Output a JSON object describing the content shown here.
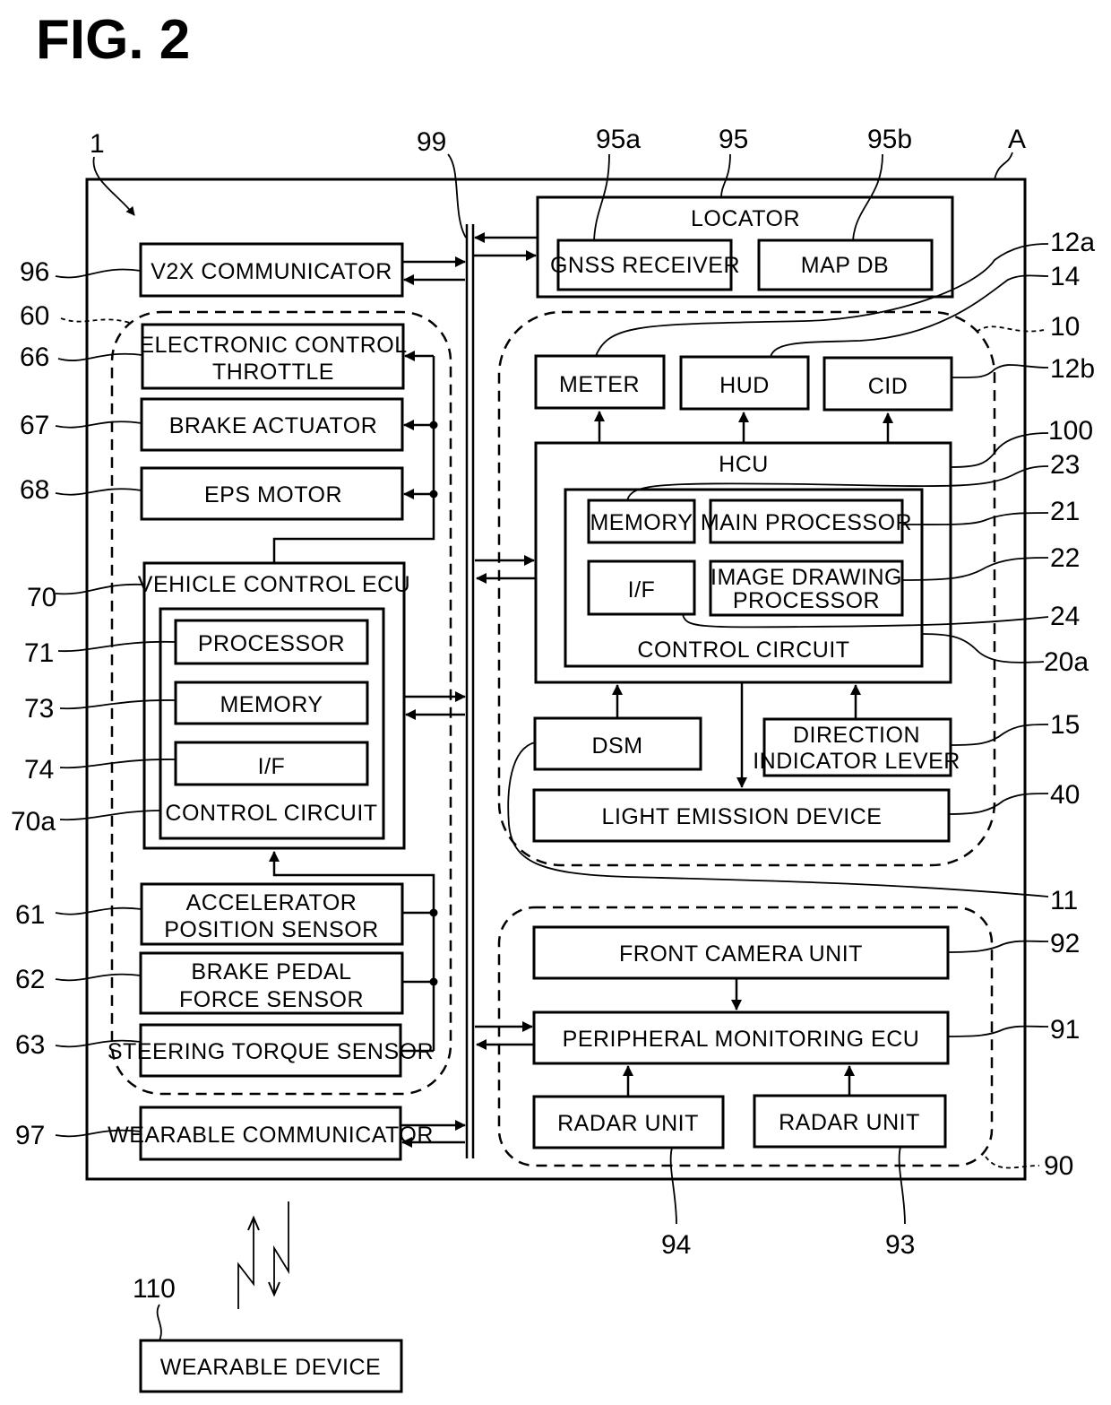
{
  "figure": {
    "title": "FIG. 2"
  },
  "refs": {
    "system": "1",
    "bus": "99",
    "locator": "95",
    "gnss": "95a",
    "mapdb": "95b",
    "vehicle": "A",
    "v2x": "96",
    "group60": "60",
    "throttle": "66",
    "brake_act": "67",
    "eps": "68",
    "vecu": "70",
    "processor": "71",
    "vmemory": "73",
    "vif": "74",
    "vcc": "70a",
    "accel": "61",
    "brake_ped": "62",
    "steer": "63",
    "wear_comm": "97",
    "meter": "12a",
    "hud": "14",
    "group10": "10",
    "cid": "12b",
    "hcu": "100",
    "hmemory": "23",
    "main_proc": "21",
    "img_proc": "22",
    "hif": "24",
    "hcc": "20a",
    "dir_lever": "15",
    "light": "40",
    "dsm": "11",
    "front_cam": "92",
    "periph_ecu": "91",
    "group90": "90",
    "radar_left": "94",
    "radar_right": "93",
    "wearable_device": "110"
  },
  "blocks": {
    "locator": "LOCATOR",
    "gnss": "GNSS RECEIVER",
    "mapdb": "MAP DB",
    "v2x": "V2X COMMUNICATOR",
    "throttle_1": "ELECTRONIC CONTROL",
    "throttle_2": "THROTTLE",
    "brake_act": "BRAKE ACTUATOR",
    "eps": "EPS MOTOR",
    "vecu": "VEHICLE CONTROL ECU",
    "processor": "PROCESSOR",
    "vmemory": "MEMORY",
    "vif": "I/F",
    "vcc": "CONTROL CIRCUIT",
    "accel_1": "ACCELERATOR",
    "accel_2": "POSITION SENSOR",
    "brake_ped_1": "BRAKE PEDAL",
    "brake_ped_2": "FORCE SENSOR",
    "steer": "STEERING TORQUE SENSOR",
    "wear_comm": "WEARABLE COMMUNICATOR",
    "meter": "METER",
    "hud": "HUD",
    "cid": "CID",
    "hcu": "HCU",
    "hmemory": "MEMORY",
    "main_proc": "MAIN PROCESSOR",
    "hif": "I/F",
    "img_proc_1": "IMAGE DRAWING",
    "img_proc_2": "PROCESSOR",
    "hcc": "CONTROL CIRCUIT",
    "dsm": "DSM",
    "dir_lever_1": "DIRECTION",
    "dir_lever_2": "INDICATOR LEVER",
    "light": "LIGHT EMISSION DEVICE",
    "front_cam": "FRONT CAMERA UNIT",
    "periph_ecu": "PERIPHERAL MONITORING ECU",
    "radar_left": "RADAR UNIT",
    "radar_right": "RADAR UNIT",
    "wearable_device": "WEARABLE DEVICE"
  }
}
